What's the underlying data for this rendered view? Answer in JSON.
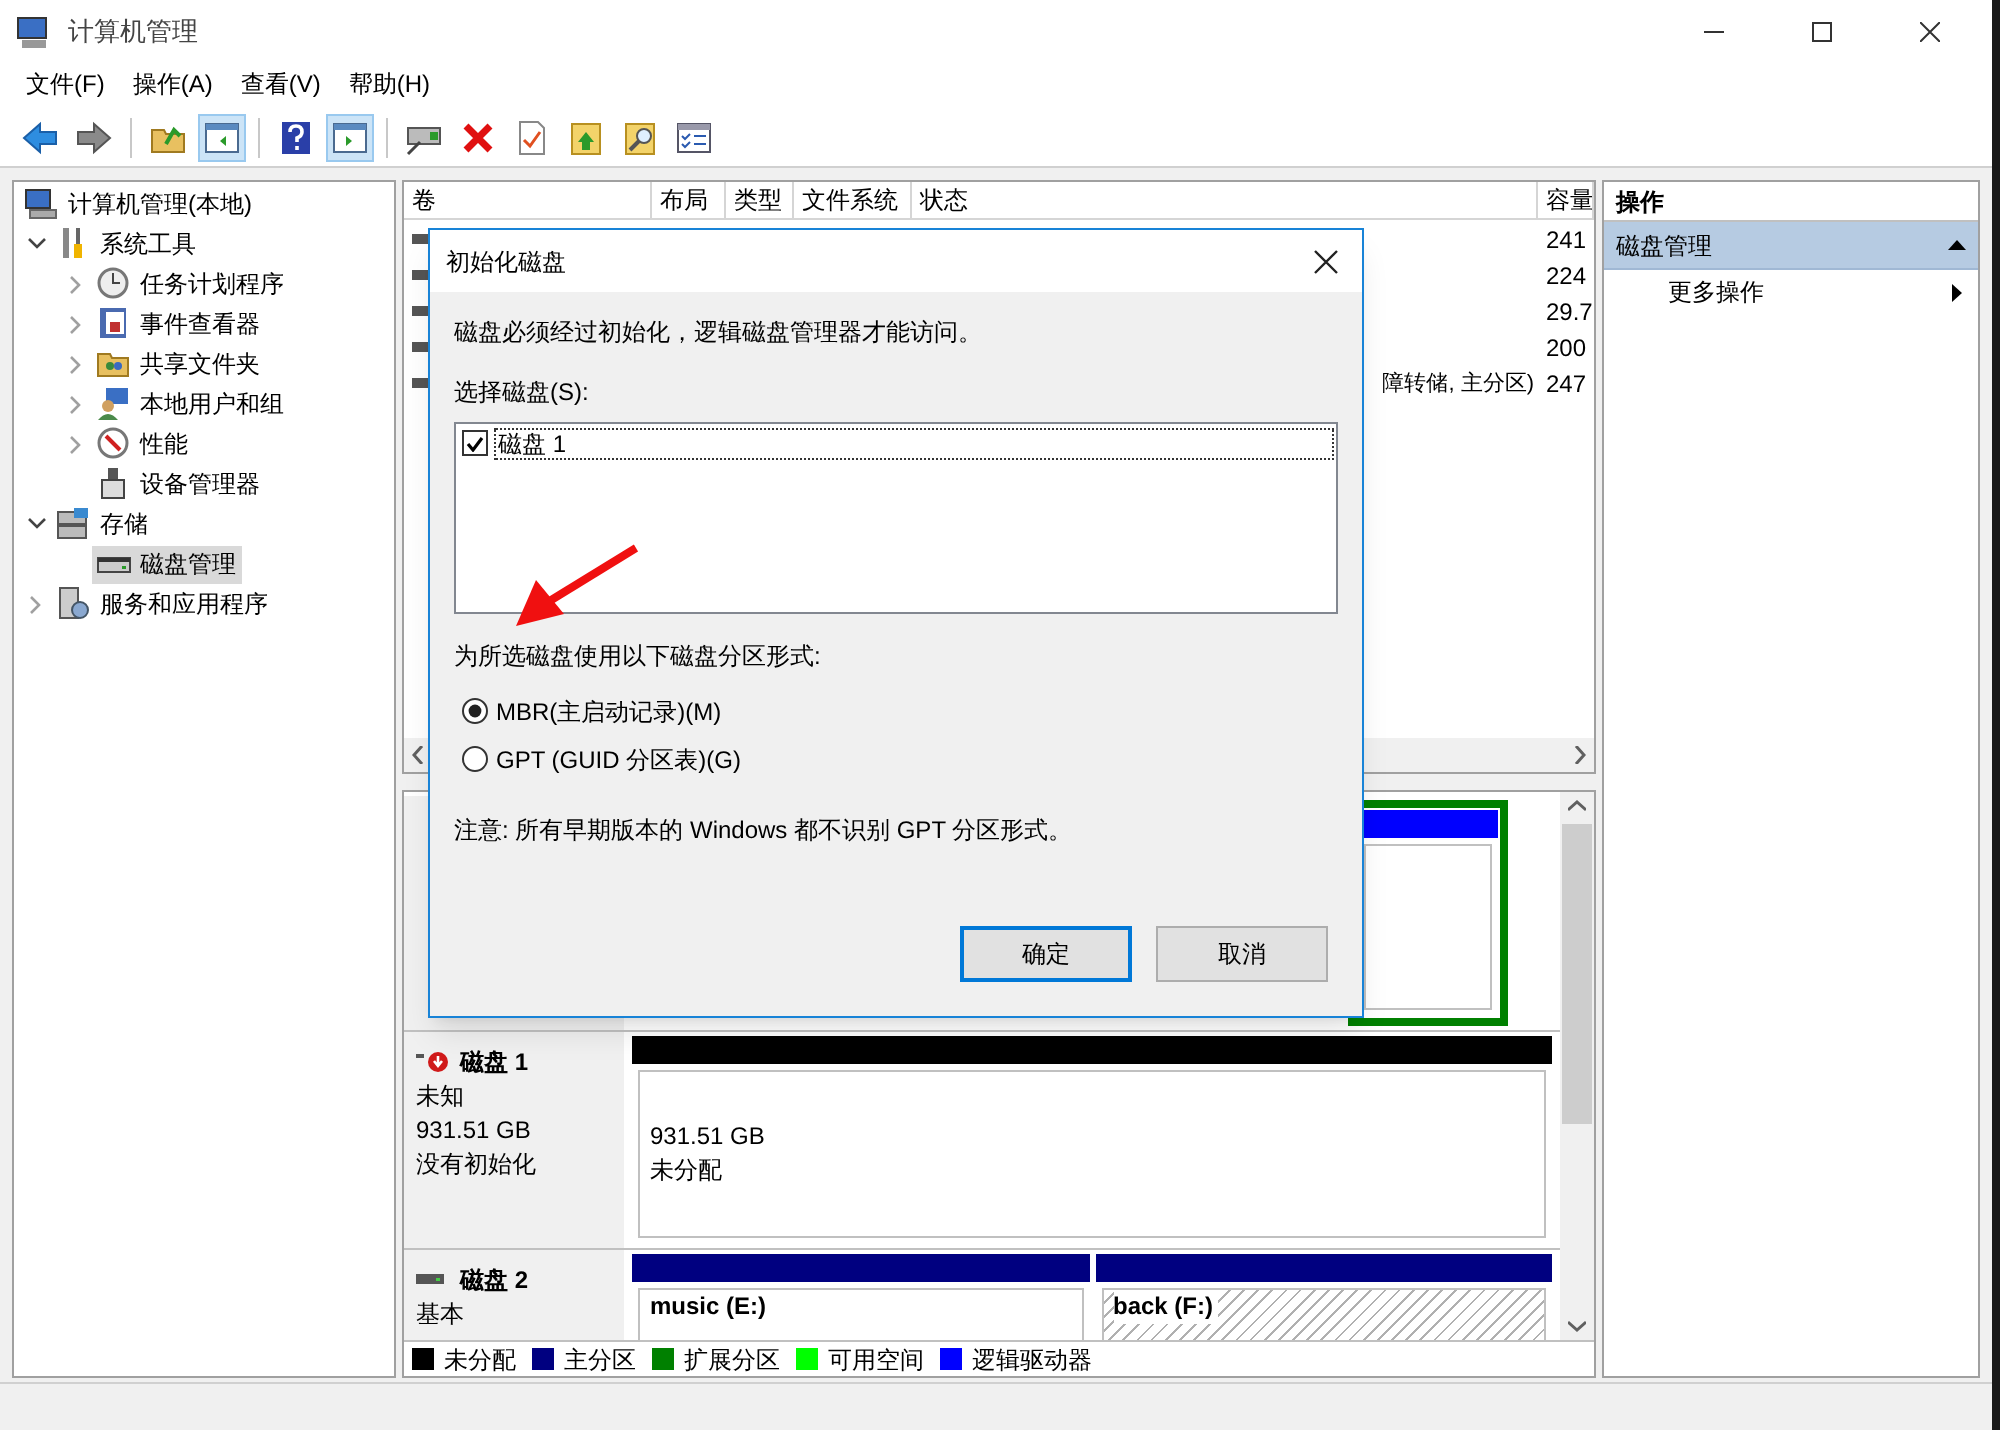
{
  "window": {
    "title": "计算机管理"
  },
  "menu": [
    "文件(F)",
    "操作(A)",
    "查看(V)",
    "帮助(H)"
  ],
  "toolbar": [
    {
      "kind": "back",
      "pressed": false
    },
    {
      "kind": "forward",
      "pressed": false
    },
    {
      "kind": "up",
      "pressed": false
    },
    {
      "kind": "pane",
      "pressed": true
    },
    {
      "kind": "help",
      "pressed": false
    },
    {
      "kind": "pane2",
      "pressed": true
    },
    {
      "kind": "connect",
      "pressed": false
    },
    {
      "kind": "delete",
      "pressed": false
    },
    {
      "kind": "check",
      "pressed": false
    },
    {
      "kind": "export",
      "pressed": false
    },
    {
      "kind": "find",
      "pressed": false
    },
    {
      "kind": "list",
      "pressed": false
    }
  ],
  "tree": [
    {
      "label": "计算机管理(本地)",
      "selected": false,
      "children": [
        {
          "label": "系统工具",
          "kind": "folder",
          "expanded": true,
          "selected": false,
          "children": [
            {
              "label": "任务计划程序",
              "kind": "folder",
              "expanded": false,
              "selected": false
            },
            {
              "label": "事件查看器",
              "kind": "folder",
              "expanded": false,
              "selected": false
            },
            {
              "label": "共享文件夹",
              "kind": "folder",
              "expanded": false,
              "selected": false
            },
            {
              "label": "本地用户和组",
              "kind": "folder",
              "expanded": false,
              "selected": false
            },
            {
              "label": "性能",
              "kind": "folder",
              "expanded": false,
              "selected": false
            },
            {
              "label": "设备管理器",
              "kind": "leaf",
              "selected": false
            }
          ]
        },
        {
          "label": "存储",
          "kind": "folder",
          "expanded": true,
          "selected": false,
          "children": [
            {
              "label": "磁盘管理",
              "kind": "leaf",
              "selected": true
            }
          ]
        },
        {
          "label": "服务和应用程序",
          "kind": "folder",
          "expanded": false,
          "selected": false
        }
      ]
    }
  ],
  "table": {
    "columns": [
      "卷",
      "布局",
      "类型",
      "文件系统",
      "状态",
      "容量"
    ],
    "rows": [
      {
        "capacity": "241"
      },
      {
        "capacity": "224"
      },
      {
        "capacity": "29.7"
      },
      {
        "capacity": "200"
      },
      {
        "status": "障转储, 主分区)",
        "capacity": "247"
      }
    ]
  },
  "disks": [
    {
      "partitions": [
        {
          "kind": "logical"
        }
      ]
    },
    {
      "name": "磁盘 1",
      "kind": "uninitialized",
      "lines": [
        "未知",
        "931.51 GB",
        "没有初始化"
      ],
      "partitions": [
        {
          "kind": "unallocated",
          "lines": [
            "931.51 GB",
            "未分配"
          ]
        }
      ]
    },
    {
      "name": "磁盘 2",
      "kind": "basic",
      "lines": [
        "基本"
      ],
      "partitions": [
        {
          "kind": "primary",
          "name": "music  (E:)",
          "hatched": false
        },
        {
          "kind": "primary",
          "name": "back  (F:)",
          "hatched": true
        }
      ]
    }
  ],
  "legend": [
    {
      "label": "未分配",
      "color": "#000000"
    },
    {
      "label": "主分区",
      "color": "#000080"
    },
    {
      "label": "扩展分区",
      "color": "#008000"
    },
    {
      "label": "可用空间",
      "color": "#00ff00"
    },
    {
      "label": "逻辑驱动器",
      "color": "#0000ff"
    }
  ],
  "actions": {
    "title": "操作",
    "section": "磁盘管理",
    "items": [
      "更多操作"
    ]
  },
  "dialog": {
    "title": "初始化磁盘",
    "message": "磁盘必须经过初始化，逻辑磁盘管理器才能访问。",
    "select_label": "选择磁盘(S):",
    "disks": [
      {
        "label": "磁盘 1",
        "checked": true
      }
    ],
    "style_label": "为所选磁盘使用以下磁盘分区形式:",
    "options": [
      {
        "label": "MBR(主启动记录)(M)",
        "selected": true
      },
      {
        "label": "GPT (GUID 分区表)(G)",
        "selected": false
      }
    ],
    "note": "注意: 所有早期版本的 Windows 都不识别 GPT 分区形式。",
    "buttons": [
      {
        "label": "确定",
        "default": true
      },
      {
        "label": "取消",
        "default": false
      }
    ]
  }
}
